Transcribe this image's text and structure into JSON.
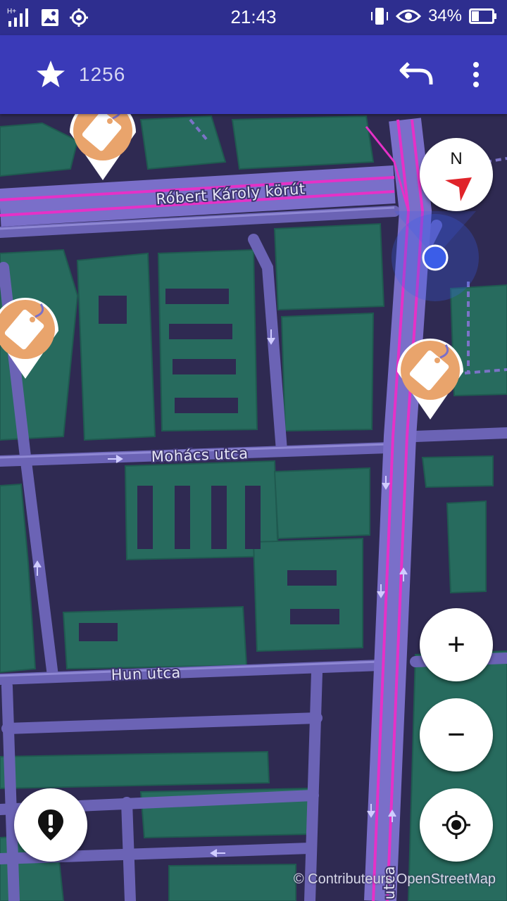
{
  "status_bar": {
    "time": "21:43",
    "battery": "34%",
    "network_label": "H+",
    "icons": [
      "signal-icon",
      "image-icon",
      "location-target-icon",
      "vibrate-icon",
      "eye-icon",
      "battery-icon"
    ]
  },
  "toolbar": {
    "score_icon": "star-icon",
    "score": "1256",
    "undo_icon": "undo-icon",
    "menu_icon": "more-vert-icon"
  },
  "map": {
    "streets": [
      "Róbert Károly körút",
      "Mohács utca",
      "Hun utca",
      "utca"
    ],
    "quest_markers": 3,
    "colors": {
      "background": "#2f2a52",
      "buildings": "#276b5e",
      "roads": "#6b63b5",
      "main_road": "#e531c7",
      "marker": "#e9a46c"
    },
    "compass_label": "N",
    "attribution": "© Contributeurs OpenStreetMap"
  },
  "controls": {
    "zoom_in": "+",
    "zoom_out": "−",
    "report_icon": "alert-marker-icon",
    "locate_icon": "my-location-icon"
  }
}
